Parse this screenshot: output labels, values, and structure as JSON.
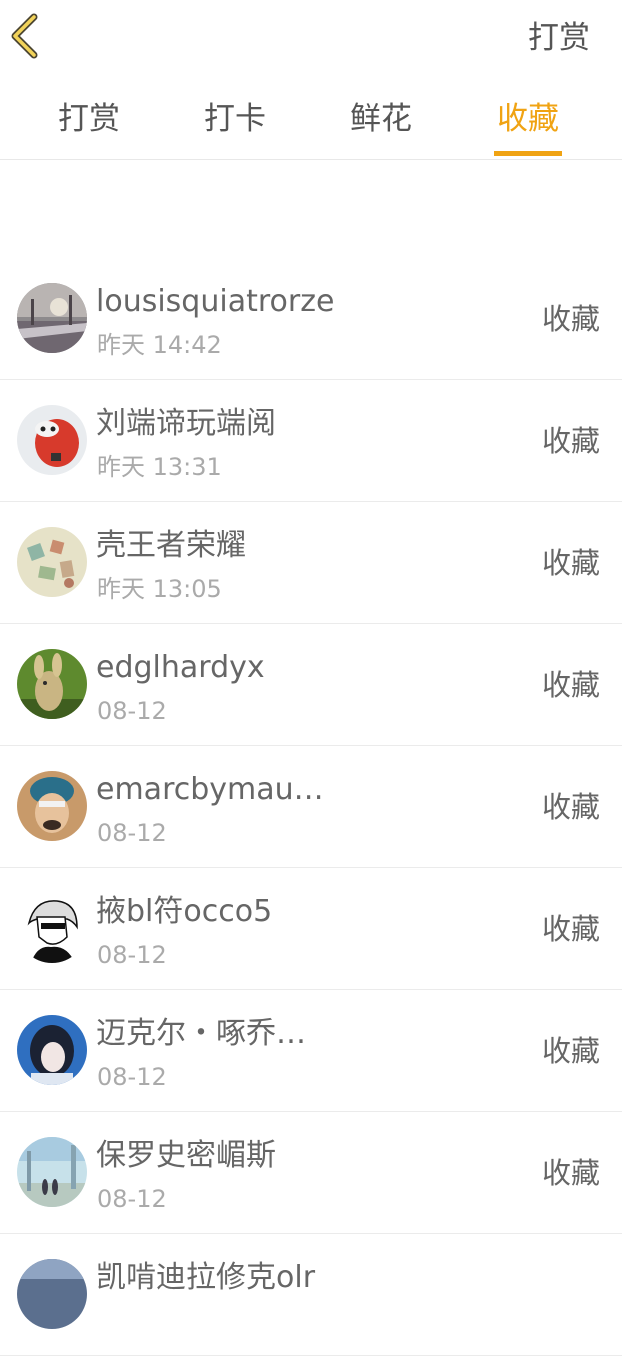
{
  "header": {
    "back_icon": "chevron-left-icon",
    "action_label": "打赏",
    "accent_color": "#f0a313"
  },
  "tabs": [
    {
      "label": "打赏",
      "active": false
    },
    {
      "label": "打卡",
      "active": false
    },
    {
      "label": "鲜花",
      "active": false
    },
    {
      "label": "收藏",
      "active": true
    }
  ],
  "list": [
    {
      "name": "lousisquiatrorze",
      "time": "昨天 14:42",
      "action": "收藏"
    },
    {
      "name": "刘端谛玩端阅",
      "time": "昨天 13:31",
      "action": "收藏"
    },
    {
      "name": "壳王者荣耀",
      "time": "昨天 13:05",
      "action": "收藏"
    },
    {
      "name": "edglhardyx",
      "time": "08-12",
      "action": "收藏"
    },
    {
      "name": "emarcbymau…",
      "time": "08-12",
      "action": "收藏"
    },
    {
      "name": "掖bl符occo5",
      "time": "08-12",
      "action": "收藏"
    },
    {
      "name": "迈克尔・啄乔…",
      "time": "08-12",
      "action": "收藏"
    },
    {
      "name": "保罗史密嵋斯",
      "time": "08-12",
      "action": "收藏"
    },
    {
      "name": "凯啃迪拉修克olr",
      "time": "",
      "action": ""
    }
  ]
}
